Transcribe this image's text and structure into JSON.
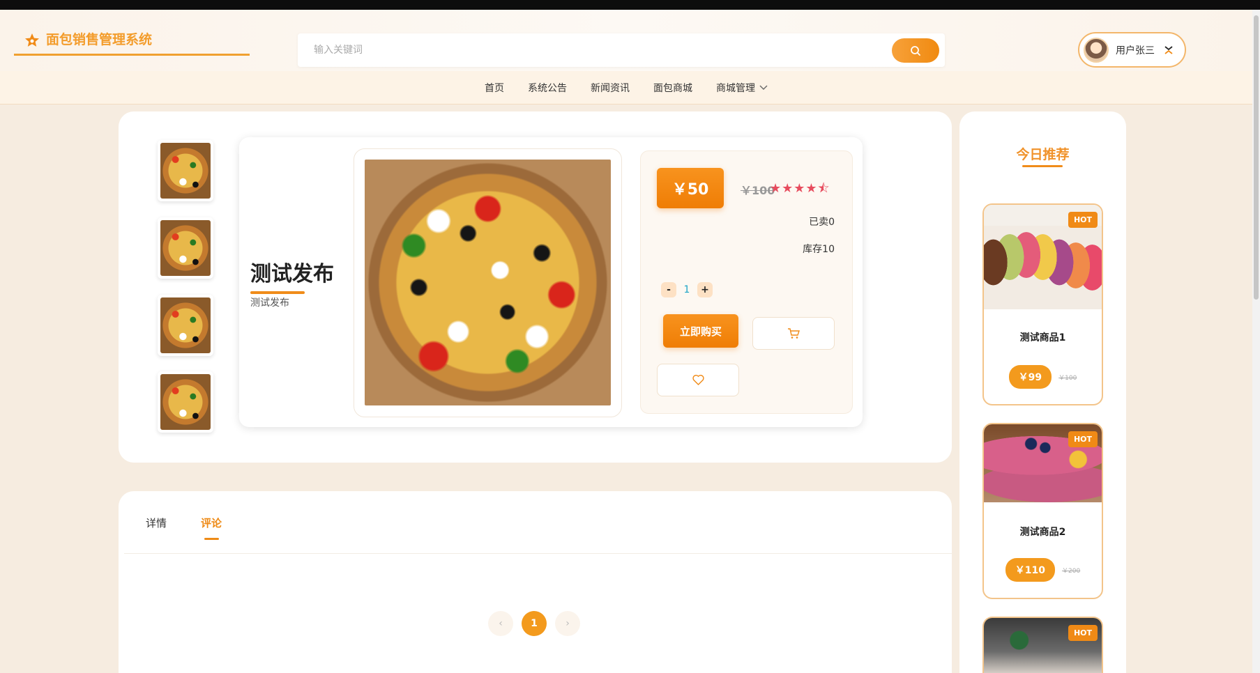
{
  "header": {
    "logo_text": "面包销售管理系统",
    "search_placeholder": "输入关键词",
    "user_name": "用户张三",
    "accent_color": "#f08a16"
  },
  "nav": {
    "items": [
      "首页",
      "系统公告",
      "新闻资讯",
      "面包商城",
      "商城管理"
    ]
  },
  "product": {
    "title": "测试发布",
    "subtitle": "测试发布",
    "price": "￥50",
    "old_price": "￥100",
    "rating": 4.5,
    "stars_text": "★★★★⯪",
    "sold": "已卖0",
    "stock": "库存10",
    "quantity": "1",
    "qty_minus": "-",
    "qty_plus": "+",
    "buy_label": "立即购买"
  },
  "tabs": {
    "detail": "详情",
    "comment": "评论"
  },
  "pagination": {
    "prev": "‹",
    "current": "1",
    "next": "›"
  },
  "sidebar": {
    "title": "今日推荐",
    "hot_label": "HOT",
    "products": [
      {
        "name": "测试商品1",
        "price": "￥99",
        "old_price": "￥100"
      },
      {
        "name": "测试商品2",
        "price": "￥110",
        "old_price": "￥200"
      }
    ]
  }
}
